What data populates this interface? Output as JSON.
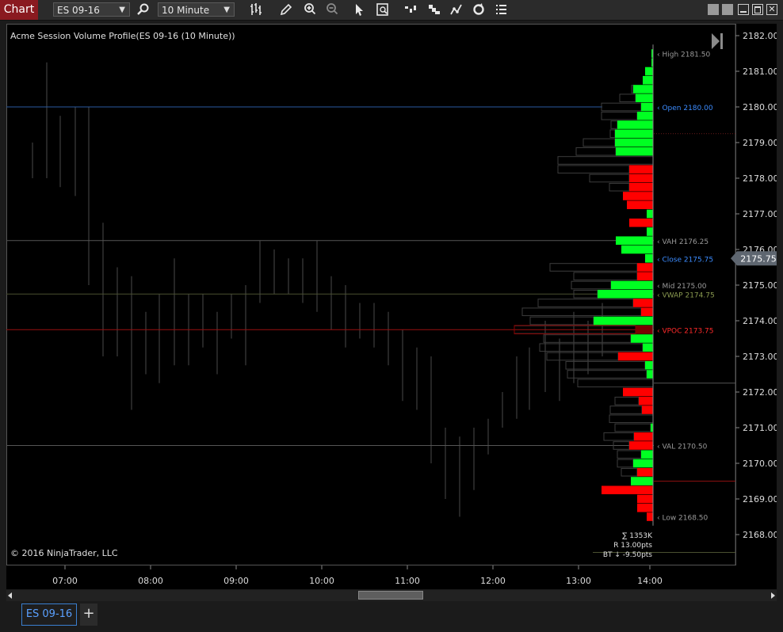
{
  "toolbar": {
    "app_label": "Chart",
    "instrument": "ES 09-16",
    "interval": "10 Minute",
    "icons": [
      "magnifier-icon",
      "bar-type-icon",
      "draw-pencil-icon",
      "zoom-in-icon",
      "zoom-out-icon",
      "pointer-icon",
      "data-box-icon",
      "chart-style-icon",
      "stair-icon",
      "strategy-icon",
      "refresh-icon",
      "properties-icon"
    ]
  },
  "chart": {
    "title": "Acme Session Volume Profile(ES 09-16 (10 Minute))",
    "copyright": "© 2016 NinjaTrader, LLC",
    "stats": {
      "sum": "∑ 1353K",
      "range": "R 13.00pts",
      "bt": "BT ↓ -9.50pts"
    },
    "price_badge": "2175.75",
    "colors": {
      "up": "#00ff22",
      "down": "#ff0000",
      "open": "#3c8cff",
      "vwap": "#6e7a3a",
      "vpoc": "#cc1111"
    }
  },
  "tabs": {
    "active": "ES 09-16",
    "add": "+"
  },
  "chart_data": {
    "type": "bar",
    "y_range": [
      2167.5,
      2182.25
    ],
    "y_ticks": [
      "2182.00",
      "2181.00",
      "2180.00",
      "2179.00",
      "2178.00",
      "2177.00",
      "2176.00",
      "2175.00",
      "2174.00",
      "2173.00",
      "2172.00",
      "2171.00",
      "2170.00",
      "2169.00",
      "2168.00"
    ],
    "x_ticks": [
      "07:00",
      "08:00",
      "09:00",
      "10:00",
      "11:00",
      "12:00",
      "13:00",
      "14:00"
    ],
    "levels": [
      {
        "name": "High",
        "label": "High 2181.50",
        "price": 2181.5,
        "color": "#9a9a9a"
      },
      {
        "name": "Open",
        "label": "Open 2180.00",
        "price": 2180.0,
        "color": "#3c8cff"
      },
      {
        "name": "VAH",
        "label": "VAH 2176.25",
        "price": 2176.25,
        "color": "#9a9a9a"
      },
      {
        "name": "Close",
        "label": "Close 2175.75",
        "price": 2175.75,
        "color": "#3c8cff"
      },
      {
        "name": "Mid",
        "label": "Mid 2175.00",
        "price": 2175.0,
        "color": "#9a9a9a"
      },
      {
        "name": "VWAP",
        "label": "VWAP 2174.75",
        "price": 2174.75,
        "color": "#8a9a50"
      },
      {
        "name": "VPOC",
        "label": "VPOC 2173.75",
        "price": 2173.75,
        "color": "#ff2a2a"
      },
      {
        "name": "VAL",
        "label": "VAL 2170.50",
        "price": 2170.5,
        "color": "#9a9a9a"
      },
      {
        "name": "Low",
        "label": "Low 2168.50",
        "price": 2168.5,
        "color": "#9a9a9a"
      }
    ],
    "profile": [
      [
        2181.5,
        2,
        0,
        "u"
      ],
      [
        2181.25,
        2,
        0,
        "u"
      ],
      [
        2181.0,
        10,
        0,
        "u"
      ],
      [
        2180.75,
        13,
        0,
        "u"
      ],
      [
        2180.5,
        25,
        2,
        "u"
      ],
      [
        2180.25,
        22,
        20,
        "u"
      ],
      [
        2180.0,
        15,
        50,
        "u"
      ],
      [
        2179.75,
        20,
        45,
        "u"
      ],
      [
        2179.5,
        45,
        8,
        "u"
      ],
      [
        2179.25,
        48,
        6,
        "u"
      ],
      [
        2179.0,
        48,
        40,
        "u"
      ],
      [
        2178.75,
        47,
        50,
        "u"
      ],
      [
        2178.5,
        0,
        120,
        "n"
      ],
      [
        2178.25,
        30,
        90,
        "d"
      ],
      [
        2178.0,
        30,
        50,
        "d"
      ],
      [
        2177.75,
        30,
        25,
        "d"
      ],
      [
        2177.5,
        38,
        0,
        "d"
      ],
      [
        2177.25,
        33,
        0,
        "d"
      ],
      [
        2177.0,
        8,
        0,
        "u"
      ],
      [
        2176.75,
        30,
        0,
        "d"
      ],
      [
        2176.5,
        8,
        0,
        "u"
      ],
      [
        2176.25,
        47,
        0,
        "u"
      ],
      [
        2176.0,
        40,
        0,
        "u"
      ],
      [
        2175.75,
        10,
        0,
        "u"
      ],
      [
        2175.5,
        20,
        110,
        "d"
      ],
      [
        2175.25,
        20,
        80,
        "d"
      ],
      [
        2175.0,
        53,
        50,
        "u"
      ],
      [
        2174.75,
        70,
        30,
        "u"
      ],
      [
        2174.5,
        25,
        120,
        "d"
      ],
      [
        2174.25,
        15,
        150,
        "d"
      ],
      [
        2174.0,
        75,
        80,
        "u"
      ],
      [
        2173.75,
        22,
        153,
        "d"
      ],
      [
        2173.5,
        28,
        110,
        "u"
      ],
      [
        2173.25,
        13,
        130,
        "u"
      ],
      [
        2173.0,
        44,
        90,
        "d"
      ],
      [
        2172.75,
        10,
        100,
        "u"
      ],
      [
        2172.5,
        8,
        100,
        "u"
      ],
      [
        2172.25,
        0,
        95,
        "n"
      ],
      [
        2172.0,
        38,
        0,
        "d"
      ],
      [
        2171.75,
        18,
        30,
        "d"
      ],
      [
        2171.5,
        14,
        40,
        "d"
      ],
      [
        2171.25,
        0,
        55,
        "n"
      ],
      [
        2171.0,
        3,
        45,
        "u"
      ],
      [
        2170.75,
        24,
        38,
        "d"
      ],
      [
        2170.5,
        30,
        20,
        "d"
      ],
      [
        2170.25,
        15,
        30,
        "u"
      ],
      [
        2170.0,
        25,
        20,
        "u"
      ],
      [
        2169.75,
        20,
        20,
        "d"
      ],
      [
        2169.5,
        28,
        0,
        "u"
      ],
      [
        2169.25,
        65,
        0,
        "d"
      ],
      [
        2169.0,
        20,
        0,
        "d"
      ],
      [
        2168.75,
        20,
        0,
        "d"
      ],
      [
        2168.5,
        8,
        0,
        "d"
      ]
    ],
    "bars": [
      [
        33,
        2179.0,
        2178.0
      ],
      [
        51,
        2181.25,
        2178.0
      ],
      [
        68,
        2179.75,
        2177.75
      ],
      [
        87,
        2180.0,
        2177.5
      ],
      [
        104,
        2180.0,
        2175.0
      ],
      [
        122,
        2176.75,
        2173.0
      ],
      [
        140,
        2175.5,
        2173.0
      ],
      [
        158,
        2175.25,
        2171.5
      ],
      [
        176,
        2174.25,
        2172.5
      ],
      [
        193,
        2174.75,
        2172.25
      ],
      [
        212,
        2175.75,
        2172.75
      ],
      [
        230,
        2174.75,
        2172.75
      ],
      [
        248,
        2174.75,
        2173.25
      ],
      [
        266,
        2174.25,
        2172.5
      ],
      [
        284,
        2174.75,
        2173.5
      ],
      [
        302,
        2175.0,
        2172.75
      ],
      [
        320,
        2176.25,
        2174.5
      ],
      [
        338,
        2176.0,
        2174.75
      ],
      [
        356,
        2175.75,
        2174.75
      ],
      [
        374,
        2175.75,
        2174.5
      ],
      [
        392,
        2176.25,
        2174.25
      ],
      [
        410,
        2175.25,
        2173.75
      ],
      [
        428,
        2175.0,
        2173.25
      ],
      [
        446,
        2174.5,
        2173.5
      ],
      [
        464,
        2174.5,
        2173.25
      ],
      [
        482,
        2174.25,
        2172.75
      ],
      [
        500,
        2173.75,
        2171.75
      ],
      [
        518,
        2173.25,
        2171.5
      ],
      [
        536,
        2173.0,
        2170.0
      ],
      [
        554,
        2171.0,
        2169.0
      ],
      [
        572,
        2170.75,
        2168.5
      ],
      [
        590,
        2171.0,
        2169.25
      ],
      [
        608,
        2171.25,
        2170.25
      ],
      [
        626,
        2172.0,
        2171.0
      ],
      [
        644,
        2173.0,
        2171.25
      ],
      [
        660,
        2173.25,
        2171.5
      ],
      [
        680,
        2174.0,
        2172.0
      ],
      [
        698,
        2173.5,
        2171.75
      ],
      [
        716,
        2174.25,
        2172.25
      ],
      [
        734,
        2174.0,
        2172.5
      ],
      [
        752,
        2174.5,
        2173.0
      ]
    ]
  }
}
